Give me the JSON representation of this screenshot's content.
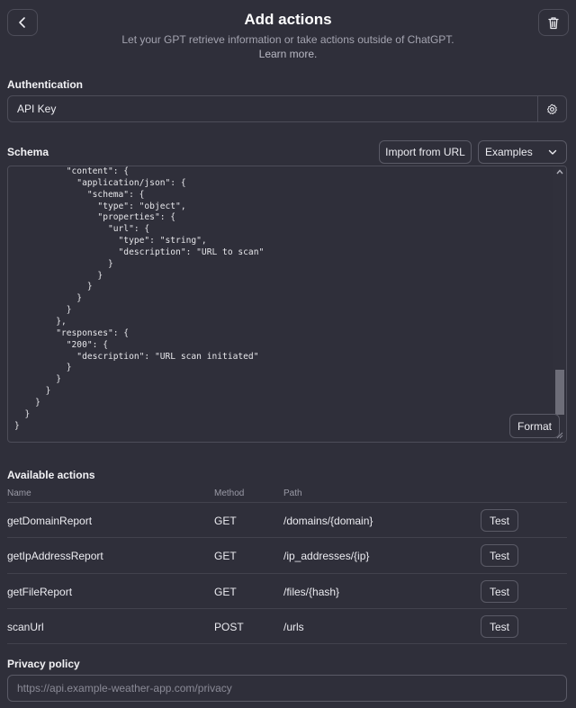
{
  "header": {
    "title": "Add actions",
    "subtitle": "Let your GPT retrieve information or take actions outside of ChatGPT.",
    "learn_more": "Learn more."
  },
  "authentication": {
    "label": "Authentication",
    "value": "API Key",
    "settings_icon": "gear-icon"
  },
  "schema": {
    "label": "Schema",
    "import_button": "Import from URL",
    "examples_select": "Examples",
    "format_button": "Format",
    "code": "          \"content\": {\n            \"application/json\": {\n              \"schema\": {\n                \"type\": \"object\",\n                \"properties\": {\n                  \"url\": {\n                    \"type\": \"string\",\n                    \"description\": \"URL to scan\"\n                  }\n                }\n              }\n            }\n          }\n        },\n        \"responses\": {\n          \"200\": {\n            \"description\": \"URL scan initiated\"\n          }\n        }\n      }\n    }\n  }\n}"
  },
  "actions": {
    "label": "Available actions",
    "columns": {
      "name": "Name",
      "method": "Method",
      "path": "Path"
    },
    "rows": [
      {
        "name": "getDomainReport",
        "method": "GET",
        "path": "/domains/{domain}",
        "test": "Test"
      },
      {
        "name": "getIpAddressReport",
        "method": "GET",
        "path": "/ip_addresses/{ip}",
        "test": "Test"
      },
      {
        "name": "getFileReport",
        "method": "GET",
        "path": "/files/{hash}",
        "test": "Test"
      },
      {
        "name": "scanUrl",
        "method": "POST",
        "path": "/urls",
        "test": "Test"
      }
    ]
  },
  "privacy": {
    "label": "Privacy policy",
    "placeholder": "https://api.example-weather-app.com/privacy"
  },
  "colors": {
    "background": "#2f2f3a",
    "border": "#4d4d59",
    "text": "#ececf1",
    "muted": "#9a9aa6"
  }
}
